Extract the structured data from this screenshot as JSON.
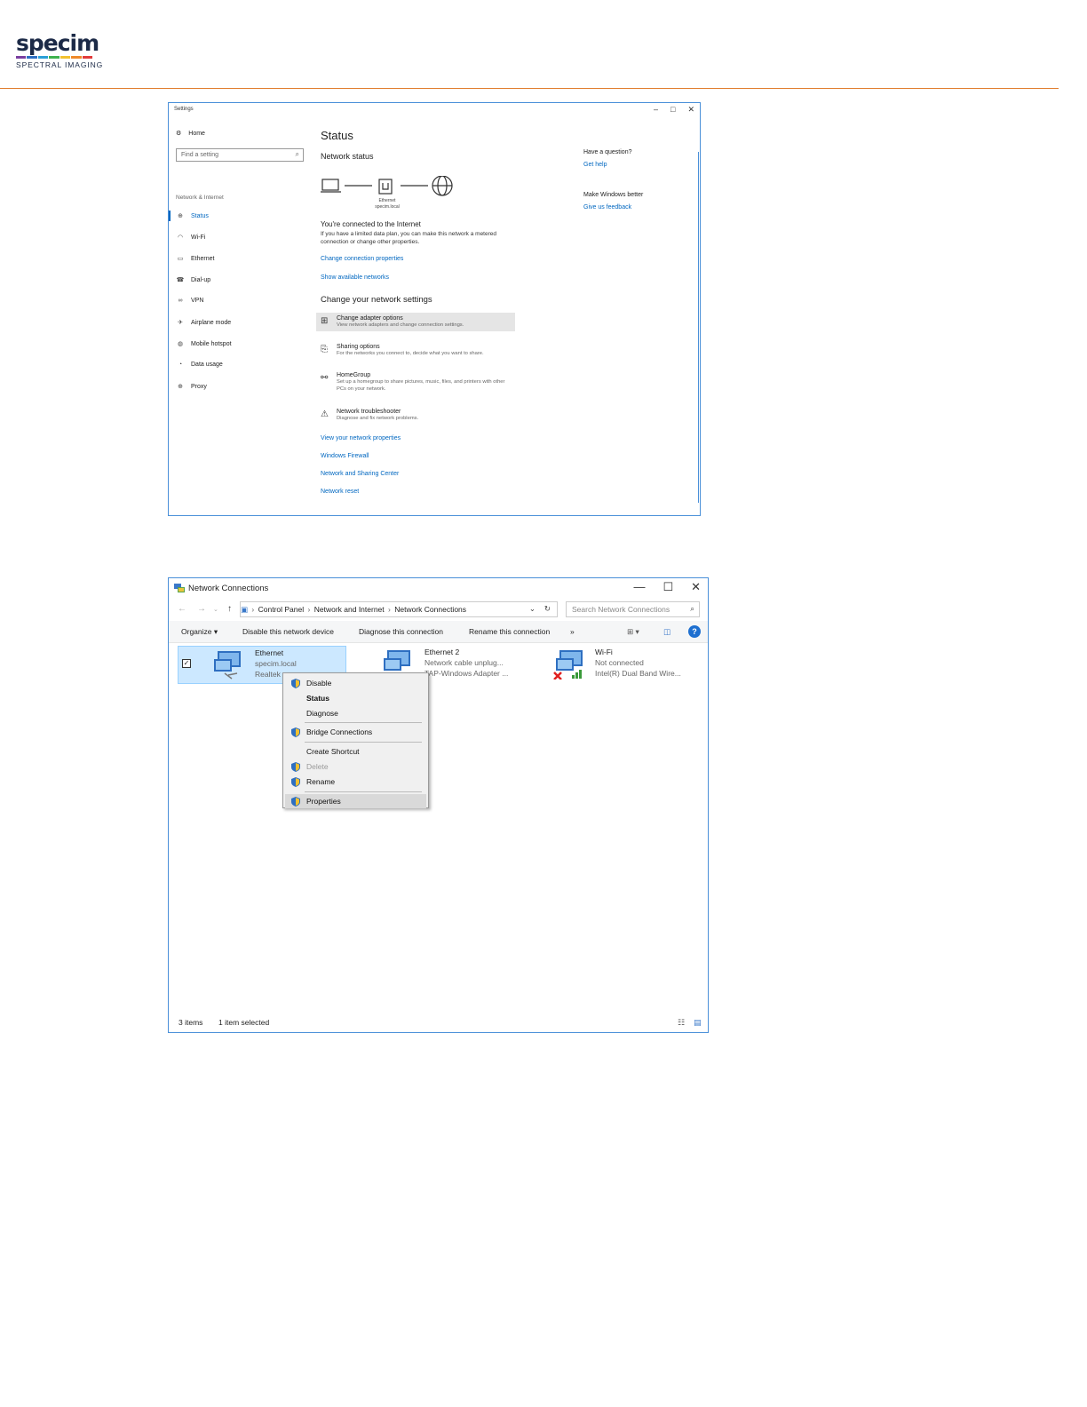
{
  "brand": {
    "name": "specim",
    "tagline": "SPECTRAL IMAGING",
    "stripe_colors": [
      "#7b3fa0",
      "#2d6fc3",
      "#2aa0d8",
      "#3fb34f",
      "#f2c12e",
      "#ef8a2a",
      "#e23b3b"
    ],
    "rule_color": "#e07b2a"
  },
  "settings": {
    "window_title": "Settings",
    "controls": [
      "–",
      "□",
      "✕"
    ],
    "home": "Home",
    "search_placeholder": "Find a setting",
    "category": "Network & Internet",
    "nav": [
      {
        "label": "Status",
        "icon": "status-icon"
      },
      {
        "label": "Wi-Fi",
        "icon": "wifi-icon"
      },
      {
        "label": "Ethernet",
        "icon": "ethernet-icon"
      },
      {
        "label": "Dial-up",
        "icon": "dialup-icon"
      },
      {
        "label": "VPN",
        "icon": "vpn-icon"
      },
      {
        "label": "Airplane mode",
        "icon": "airplane-icon"
      },
      {
        "label": "Mobile hotspot",
        "icon": "hotspot-icon"
      },
      {
        "label": "Data usage",
        "icon": "data-usage-icon"
      },
      {
        "label": "Proxy",
        "icon": "proxy-icon"
      }
    ],
    "page_title": "Status",
    "network_status": "Network status",
    "diagram_label": "Ethernet",
    "diagram_sub": "specim.local",
    "connected": "You're connected to the Internet",
    "metered": "If you have a limited data plan, you can make this network a metered connection or change other properties.",
    "link_change_props": "Change connection properties",
    "link_show_networks": "Show available networks",
    "change_heading": "Change your network settings",
    "options": [
      {
        "title": "Change adapter options",
        "desc": "View network adapters and change connection settings.",
        "icon": "adapter-icon"
      },
      {
        "title": "Sharing options",
        "desc": "For the networks you connect to, decide what you want to share.",
        "icon": "sharing-icon"
      },
      {
        "title": "HomeGroup",
        "desc": "Set up a homegroup to share pictures, music, files, and printers with other PCs on your network.",
        "icon": "homegroup-icon"
      },
      {
        "title": "Network troubleshooter",
        "desc": "Diagnose and fix network problems.",
        "icon": "warning-icon"
      }
    ],
    "links": [
      "View your network properties",
      "Windows Firewall",
      "Network and Sharing Center",
      "Network reset"
    ],
    "side": {
      "question": "Have a question?",
      "get_help": "Get help",
      "better": "Make Windows better",
      "feedback": "Give us feedback"
    }
  },
  "network": {
    "window_title": "Network Connections",
    "controls": [
      "—",
      "☐",
      "✕"
    ],
    "breadcrumb": [
      "Control Panel",
      "Network and Internet",
      "Network Connections"
    ],
    "search_placeholder": "Search Network Connections",
    "commands": [
      "Organize ▾",
      "Disable this network device",
      "Diagnose this connection",
      "Rename this connection",
      "»"
    ],
    "items": [
      {
        "name": "Ethernet",
        "line1": "specim.local",
        "line2": "Realtek"
      },
      {
        "name": "Ethernet 2",
        "line1": "Network cable unplug...",
        "line2": "TAP-Windows Adapter ..."
      },
      {
        "name": "Wi-Fi",
        "line1": "Not connected",
        "line2": "Intel(R) Dual Band Wire..."
      }
    ],
    "context_menu": [
      {
        "label": "Disable",
        "shield": true
      },
      {
        "label": "Status",
        "shield": false
      },
      {
        "label": "Diagnose",
        "shield": false
      },
      {
        "label": "Bridge Connections",
        "shield": true
      },
      {
        "label": "Create Shortcut",
        "shield": false
      },
      {
        "label": "Delete",
        "shield": true
      },
      {
        "label": "Rename",
        "shield": true
      },
      {
        "label": "Properties",
        "shield": true
      }
    ],
    "status_items": "3 items",
    "status_selected": "1 item selected"
  }
}
